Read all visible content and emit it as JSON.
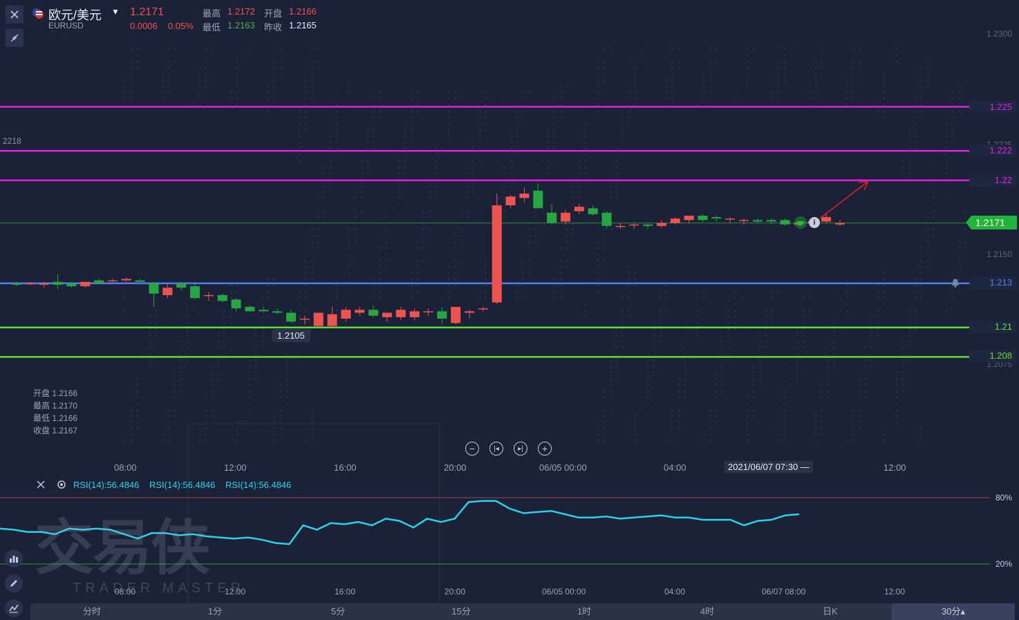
{
  "header": {
    "pair_name": "欧元/美元",
    "symbol": "EURUSD",
    "price": "1.2171",
    "change": "0.0006",
    "change_pct": "0.05%",
    "high_label": "最高",
    "high_value": "1.2172",
    "open_label": "开盘",
    "open_value": "1.2166",
    "low_label": "最低",
    "low_value": "1.2163",
    "prev_close_label": "昨收",
    "prev_close_value": "1.2165"
  },
  "price_axis": {
    "ticks": [
      "1.2300",
      "1.2225",
      "1.2150",
      "1.2075"
    ],
    "current_price": "1.2171",
    "left_edge_label": "2218",
    "low_marker": "1.2105"
  },
  "lines": [
    {
      "price": "1.225",
      "color": "#e020e6"
    },
    {
      "price": "1.222",
      "color": "#e020e6"
    },
    {
      "price": "1.22",
      "color": "#e020e6"
    },
    {
      "price": "1.213",
      "color": "#4f7ff0"
    },
    {
      "price": "1.21",
      "color": "#5fe030"
    },
    {
      "price": "1.208",
      "color": "#5fe030"
    }
  ],
  "ohlc_box": {
    "open": "开盘 1.2166",
    "high": "最高 1.2170",
    "low": "最低 1.2166",
    "close": "收盘 1.2167"
  },
  "time_axis": [
    "08:00",
    "12:00",
    "16:00",
    "20:00",
    "06/05 00:00",
    "04:00",
    "12:00"
  ],
  "crosshair_time": "2021/06/07 07:30 —",
  "rsi": {
    "labels": [
      "RSI(14):56.4846",
      "RSI(14):56.4846",
      "RSI(14):56.4846"
    ],
    "level_high": "80%",
    "level_low": "20%",
    "time_axis": [
      "08:00",
      "12:00",
      "16:00",
      "20:00",
      "06/05 00:00",
      "04:00",
      "06/07 08:00",
      "12:00"
    ]
  },
  "watermark": {
    "cn": "交易侠",
    "en": "TRADER MASTER"
  },
  "tabs": [
    "分时",
    "1分",
    "5分",
    "15分",
    "1时",
    "4时",
    "日K",
    "30分▴"
  ],
  "colors": {
    "up": "#ef5350",
    "down": "#26a641",
    "rsi": "#29d3ea",
    "bg": "#1b2237"
  },
  "chart_data": {
    "type": "candlestick",
    "ylim": [
      1.2065,
      1.2305
    ],
    "candles": [
      [
        1.213,
        1.2131,
        1.2128,
        1.2129
      ],
      [
        1.213,
        1.2131,
        1.2129,
        1.213
      ],
      [
        1.2129,
        1.2131,
        1.2127,
        1.213
      ],
      [
        1.2131,
        1.2136,
        1.2126,
        1.2129
      ],
      [
        1.213,
        1.2131,
        1.2127,
        1.2128
      ],
      [
        1.2128,
        1.2131,
        1.2127,
        1.2131
      ],
      [
        1.2132,
        1.2133,
        1.213,
        1.213
      ],
      [
        1.2132,
        1.2133,
        1.2131,
        1.2132
      ],
      [
        1.2132,
        1.2134,
        1.2131,
        1.2133
      ],
      [
        1.2132,
        1.2133,
        1.213,
        1.2131
      ],
      [
        1.213,
        1.2131,
        1.2114,
        1.2123
      ],
      [
        1.2122,
        1.213,
        1.212,
        1.2127
      ],
      [
        1.213,
        1.2131,
        1.2125,
        1.2127
      ],
      [
        1.2128,
        1.213,
        1.2119,
        1.212
      ],
      [
        1.2122,
        1.2124,
        1.2118,
        1.2122
      ],
      [
        1.2122,
        1.2123,
        1.2117,
        1.2118
      ],
      [
        1.2119,
        1.212,
        1.2111,
        1.2113
      ],
      [
        1.2114,
        1.2115,
        1.2111,
        1.2111
      ],
      [
        1.2112,
        1.2114,
        1.211,
        1.2111
      ],
      [
        1.2111,
        1.2113,
        1.2109,
        1.211
      ],
      [
        1.211,
        1.2112,
        1.2103,
        1.2104
      ],
      [
        1.2106,
        1.2108,
        1.2102,
        1.2106
      ],
      [
        1.2101,
        1.211,
        1.21,
        1.211
      ],
      [
        1.2101,
        1.2114,
        1.21,
        1.2109
      ],
      [
        1.2106,
        1.2114,
        1.2104,
        1.2112
      ],
      [
        1.211,
        1.2114,
        1.2108,
        1.2112
      ],
      [
        1.2112,
        1.2115,
        1.2107,
        1.2108
      ],
      [
        1.2107,
        1.211,
        1.2104,
        1.211
      ],
      [
        1.2107,
        1.2114,
        1.2105,
        1.2112
      ],
      [
        1.2107,
        1.2113,
        1.2105,
        1.2111
      ],
      [
        1.2111,
        1.2113,
        1.2108,
        1.2111
      ],
      [
        1.2111,
        1.2114,
        1.2102,
        1.2106
      ],
      [
        1.2103,
        1.2114,
        1.2102,
        1.2114
      ],
      [
        1.211,
        1.2112,
        1.2106,
        1.2111
      ],
      [
        1.2113,
        1.2114,
        1.2111,
        1.2113
      ],
      [
        1.2117,
        1.2191,
        1.2116,
        1.2183
      ],
      [
        1.2183,
        1.219,
        1.2181,
        1.2189
      ],
      [
        1.2188,
        1.2195,
        1.2185,
        1.2191
      ],
      [
        1.2193,
        1.2198,
        1.2186,
        1.2181
      ],
      [
        1.2178,
        1.2184,
        1.217,
        1.2171
      ],
      [
        1.2172,
        1.218,
        1.217,
        1.2178
      ],
      [
        1.2179,
        1.2184,
        1.2177,
        1.2182
      ],
      [
        1.2181,
        1.2183,
        1.2176,
        1.2177
      ],
      [
        1.2178,
        1.2179,
        1.2167,
        1.2169
      ],
      [
        1.2169,
        1.2171,
        1.2167,
        1.2169
      ],
      [
        1.217,
        1.2171,
        1.2167,
        1.217
      ],
      [
        1.217,
        1.2171,
        1.2167,
        1.2169
      ],
      [
        1.2169,
        1.2173,
        1.2168,
        1.2171
      ],
      [
        1.2171,
        1.2175,
        1.217,
        1.2174
      ],
      [
        1.2173,
        1.2176,
        1.2171,
        1.2176
      ],
      [
        1.2176,
        1.2177,
        1.2172,
        1.2173
      ],
      [
        1.2175,
        1.2176,
        1.2172,
        1.2174
      ],
      [
        1.2174,
        1.2175,
        1.2171,
        1.2174
      ],
      [
        1.2173,
        1.2174,
        1.217,
        1.2173
      ],
      [
        1.2173,
        1.2174,
        1.2171,
        1.2172
      ],
      [
        1.2173,
        1.2174,
        1.217,
        1.2172
      ],
      [
        1.2173,
        1.2174,
        1.2169,
        1.217
      ],
      [
        1.217,
        1.2172,
        1.2169,
        1.2171
      ],
      [
        1.2171,
        1.2173,
        1.217,
        1.2172
      ],
      [
        1.2172,
        1.2178,
        1.2171,
        1.2175
      ],
      [
        1.217,
        1.2173,
        1.2169,
        1.2171
      ]
    ],
    "rsi_values": [
      52,
      51,
      49,
      49,
      47,
      52,
      51,
      52,
      51,
      47,
      43,
      48,
      48,
      46,
      47,
      45,
      44,
      43,
      44,
      42,
      39,
      38,
      55,
      51,
      57,
      56,
      58,
      55,
      61,
      59,
      53,
      61,
      58,
      61,
      76,
      77,
      77,
      70,
      66,
      67,
      68,
      65,
      62,
      62,
      63,
      61,
      62,
      63,
      64,
      62,
      62,
      60,
      60,
      60,
      55,
      59,
      60,
      64,
      65
    ]
  }
}
